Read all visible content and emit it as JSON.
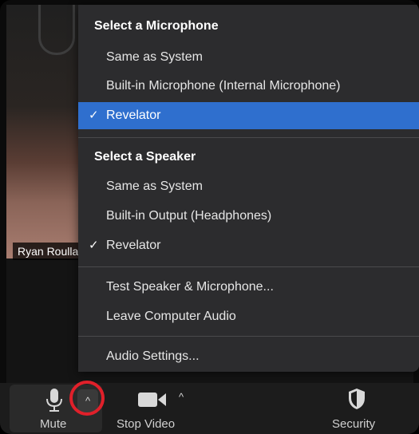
{
  "video": {
    "participant_name": "Ryan Roulla"
  },
  "audio_menu": {
    "microphone_header": "Select a Microphone",
    "microphones": [
      {
        "label": "Same as System",
        "checked": false
      },
      {
        "label": "Built-in Microphone (Internal Microphone)",
        "checked": false
      },
      {
        "label": "Revelator",
        "checked": true
      }
    ],
    "speaker_header": "Select a Speaker",
    "speakers": [
      {
        "label": "Same as System",
        "checked": false
      },
      {
        "label": "Built-in Output (Headphones)",
        "checked": false
      },
      {
        "label": "Revelator",
        "checked": true
      }
    ],
    "actions": [
      "Test Speaker & Microphone...",
      "Leave Computer Audio"
    ],
    "settings": "Audio Settings...",
    "check_glyph": "✓",
    "highlight_color": "#2f6fce"
  },
  "toolbar": {
    "mute_label": "Mute",
    "stop_video_label": "Stop Video",
    "security_label": "Security",
    "caret_glyph": "^",
    "icons": [
      "microphone-icon",
      "caret-up-icon",
      "video-camera-icon",
      "shield-icon"
    ],
    "annotation_color": "#e0202a"
  }
}
